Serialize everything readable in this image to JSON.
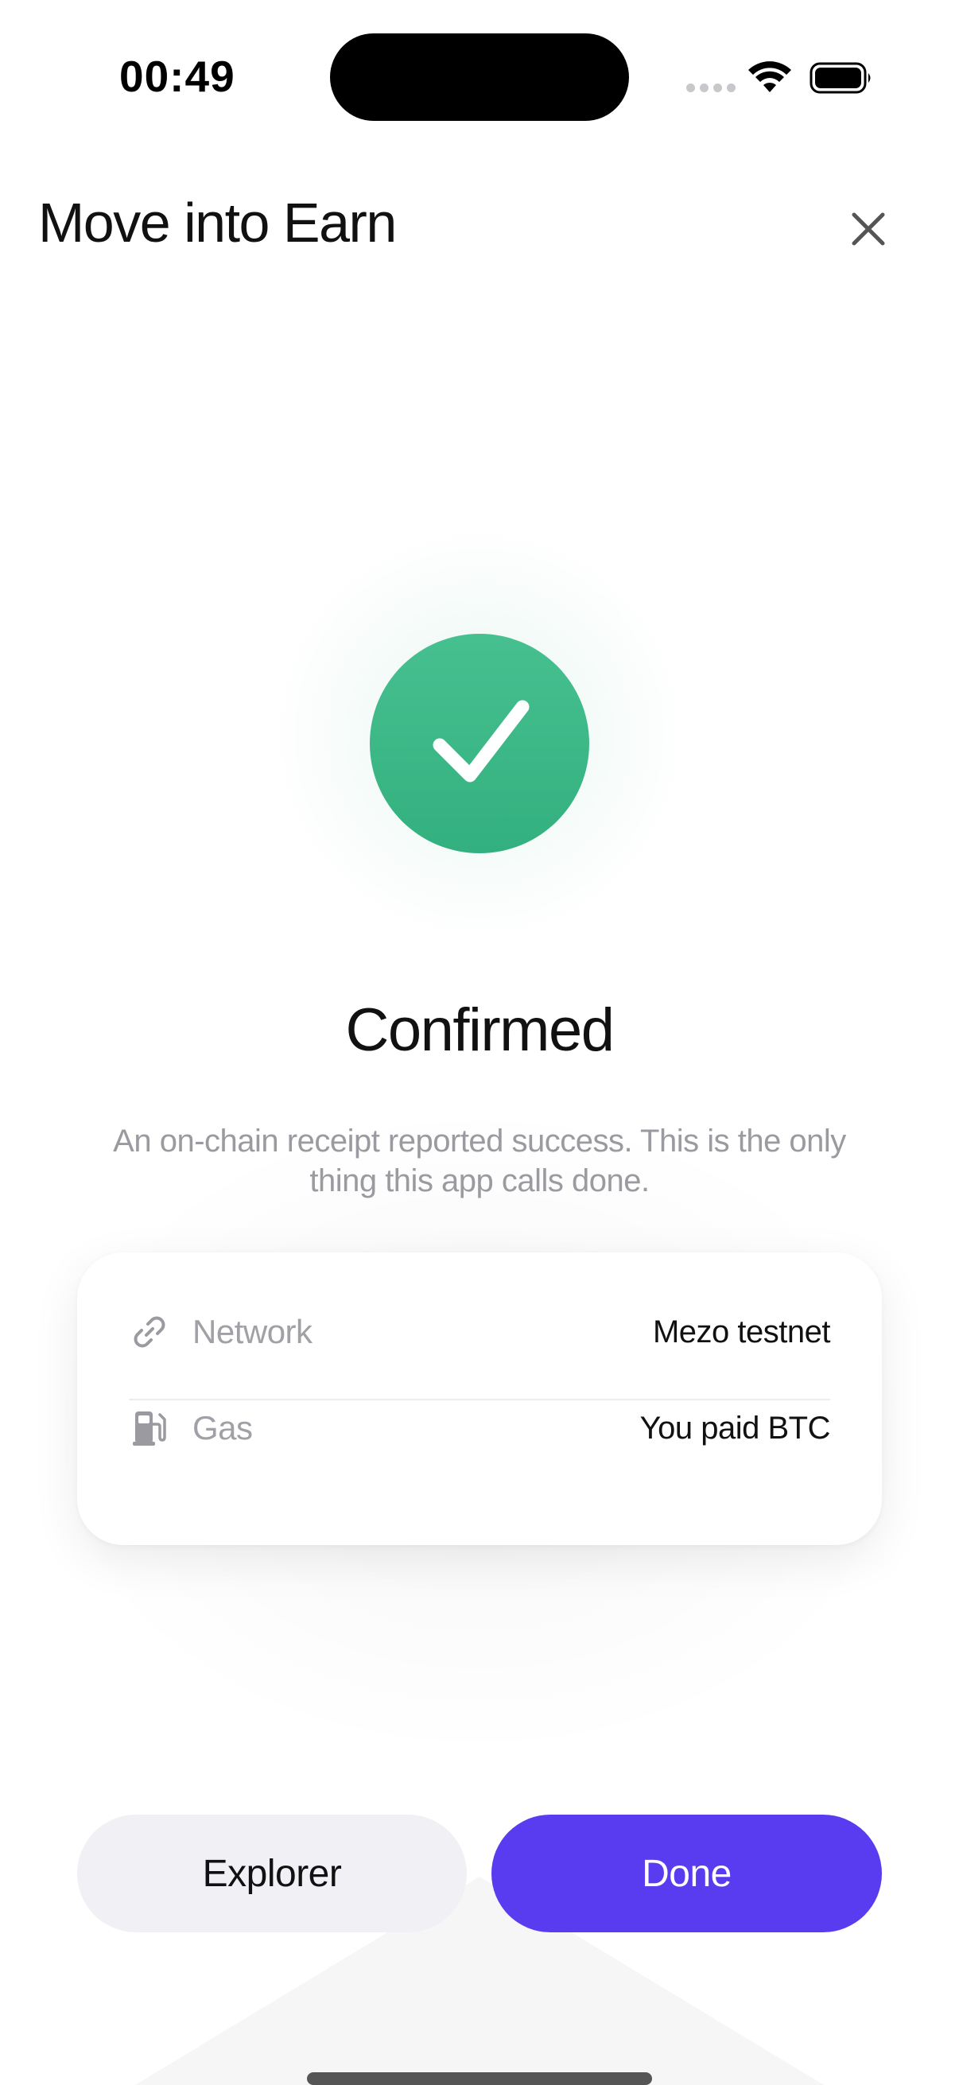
{
  "status_bar": {
    "time": "00:49"
  },
  "header": {
    "title": "Move into Earn",
    "close_icon": "close-icon"
  },
  "success": {
    "icon": "checkmark-icon",
    "title": "Confirmed",
    "description": "An on-chain receipt reported success. This is the only thing this app calls done."
  },
  "details": {
    "rows": [
      {
        "icon": "link-icon",
        "label": "Network",
        "value": "Mezo testnet"
      },
      {
        "icon": "gas-pump-icon",
        "label": "Gas",
        "value": "You paid BTC"
      }
    ]
  },
  "actions": {
    "explorer_label": "Explorer",
    "done_label": "Done"
  },
  "colors": {
    "success_green": "#3bb886",
    "primary": "#5a3cf0",
    "secondary_button": "#f1f0f5",
    "muted_text": "#9a9aa0"
  }
}
